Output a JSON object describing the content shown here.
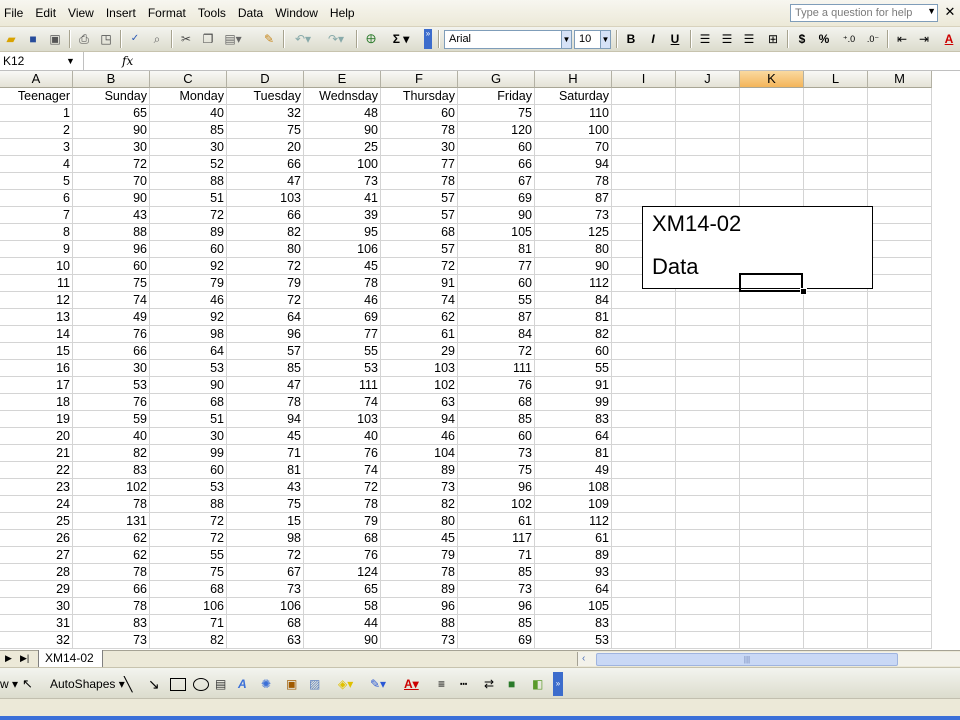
{
  "menu": [
    "File",
    "Edit",
    "View",
    "Insert",
    "Format",
    "Tools",
    "Data",
    "Window",
    "Help"
  ],
  "help_placeholder": "Type a question for help",
  "toolbar": {
    "font_name": "Arial",
    "font_size": "10",
    "bold": "B",
    "italic": "I",
    "underline": "U",
    "sigma": "Σ",
    "currency": "$",
    "percent": "%"
  },
  "formula_bar": {
    "name_box": "K12",
    "fx": "fx",
    "content": ""
  },
  "columns": [
    "A",
    "B",
    "C",
    "D",
    "E",
    "F",
    "G",
    "H",
    "I",
    "J",
    "K",
    "L",
    "M"
  ],
  "selected_column": "K",
  "headers": [
    "Teenager",
    "Sunday",
    "Monday",
    "Tuesday",
    "Wednsday",
    "Thursday",
    "Friday",
    "Saturday"
  ],
  "rows": [
    [
      1,
      65,
      40,
      32,
      48,
      60,
      75,
      110
    ],
    [
      2,
      90,
      85,
      75,
      90,
      78,
      120,
      100
    ],
    [
      3,
      30,
      30,
      20,
      25,
      30,
      60,
      70
    ],
    [
      4,
      72,
      52,
      66,
      100,
      77,
      66,
      94
    ],
    [
      5,
      70,
      88,
      47,
      73,
      78,
      67,
      78
    ],
    [
      6,
      90,
      51,
      103,
      41,
      57,
      69,
      87
    ],
    [
      7,
      43,
      72,
      66,
      39,
      57,
      90,
      73
    ],
    [
      8,
      88,
      89,
      82,
      95,
      68,
      105,
      125
    ],
    [
      9,
      96,
      60,
      80,
      106,
      57,
      81,
      80
    ],
    [
      10,
      60,
      92,
      72,
      45,
      72,
      77,
      90
    ],
    [
      11,
      75,
      79,
      79,
      78,
      91,
      60,
      112
    ],
    [
      12,
      74,
      46,
      72,
      46,
      74,
      55,
      84
    ],
    [
      13,
      49,
      92,
      64,
      69,
      62,
      87,
      81
    ],
    [
      14,
      76,
      98,
      96,
      77,
      61,
      84,
      82
    ],
    [
      15,
      66,
      64,
      57,
      55,
      29,
      72,
      60
    ],
    [
      16,
      30,
      53,
      85,
      53,
      103,
      111,
      55
    ],
    [
      17,
      53,
      90,
      47,
      111,
      102,
      76,
      91
    ],
    [
      18,
      76,
      68,
      78,
      74,
      63,
      68,
      99
    ],
    [
      19,
      59,
      51,
      94,
      103,
      94,
      85,
      83
    ],
    [
      20,
      40,
      30,
      45,
      40,
      46,
      60,
      64
    ],
    [
      21,
      82,
      99,
      71,
      76,
      104,
      73,
      81
    ],
    [
      22,
      83,
      60,
      81,
      74,
      89,
      75,
      49
    ],
    [
      23,
      102,
      53,
      43,
      72,
      73,
      96,
      108
    ],
    [
      24,
      78,
      88,
      75,
      78,
      82,
      102,
      109
    ],
    [
      25,
      131,
      72,
      15,
      79,
      80,
      61,
      112
    ],
    [
      26,
      62,
      72,
      98,
      68,
      45,
      117,
      61
    ],
    [
      27,
      62,
      55,
      72,
      76,
      79,
      71,
      89
    ],
    [
      28,
      78,
      75,
      67,
      124,
      78,
      85,
      93
    ],
    [
      29,
      66,
      68,
      73,
      65,
      89,
      73,
      64
    ],
    [
      30,
      78,
      106,
      106,
      58,
      96,
      96,
      105
    ],
    [
      31,
      83,
      71,
      68,
      44,
      88,
      85,
      83
    ],
    [
      32,
      73,
      82,
      63,
      90,
      73,
      69,
      53
    ]
  ],
  "textbox": {
    "line1": "XM14-02",
    "line2": "Data"
  },
  "sheet_tab": "XM14-02",
  "drawing": {
    "autoshapes": "AutoShapes"
  },
  "colors": {
    "selected_header": "#f4b55a",
    "toolbar_bg": "#ece9d8",
    "taskbar": "#3a6fd8"
  }
}
